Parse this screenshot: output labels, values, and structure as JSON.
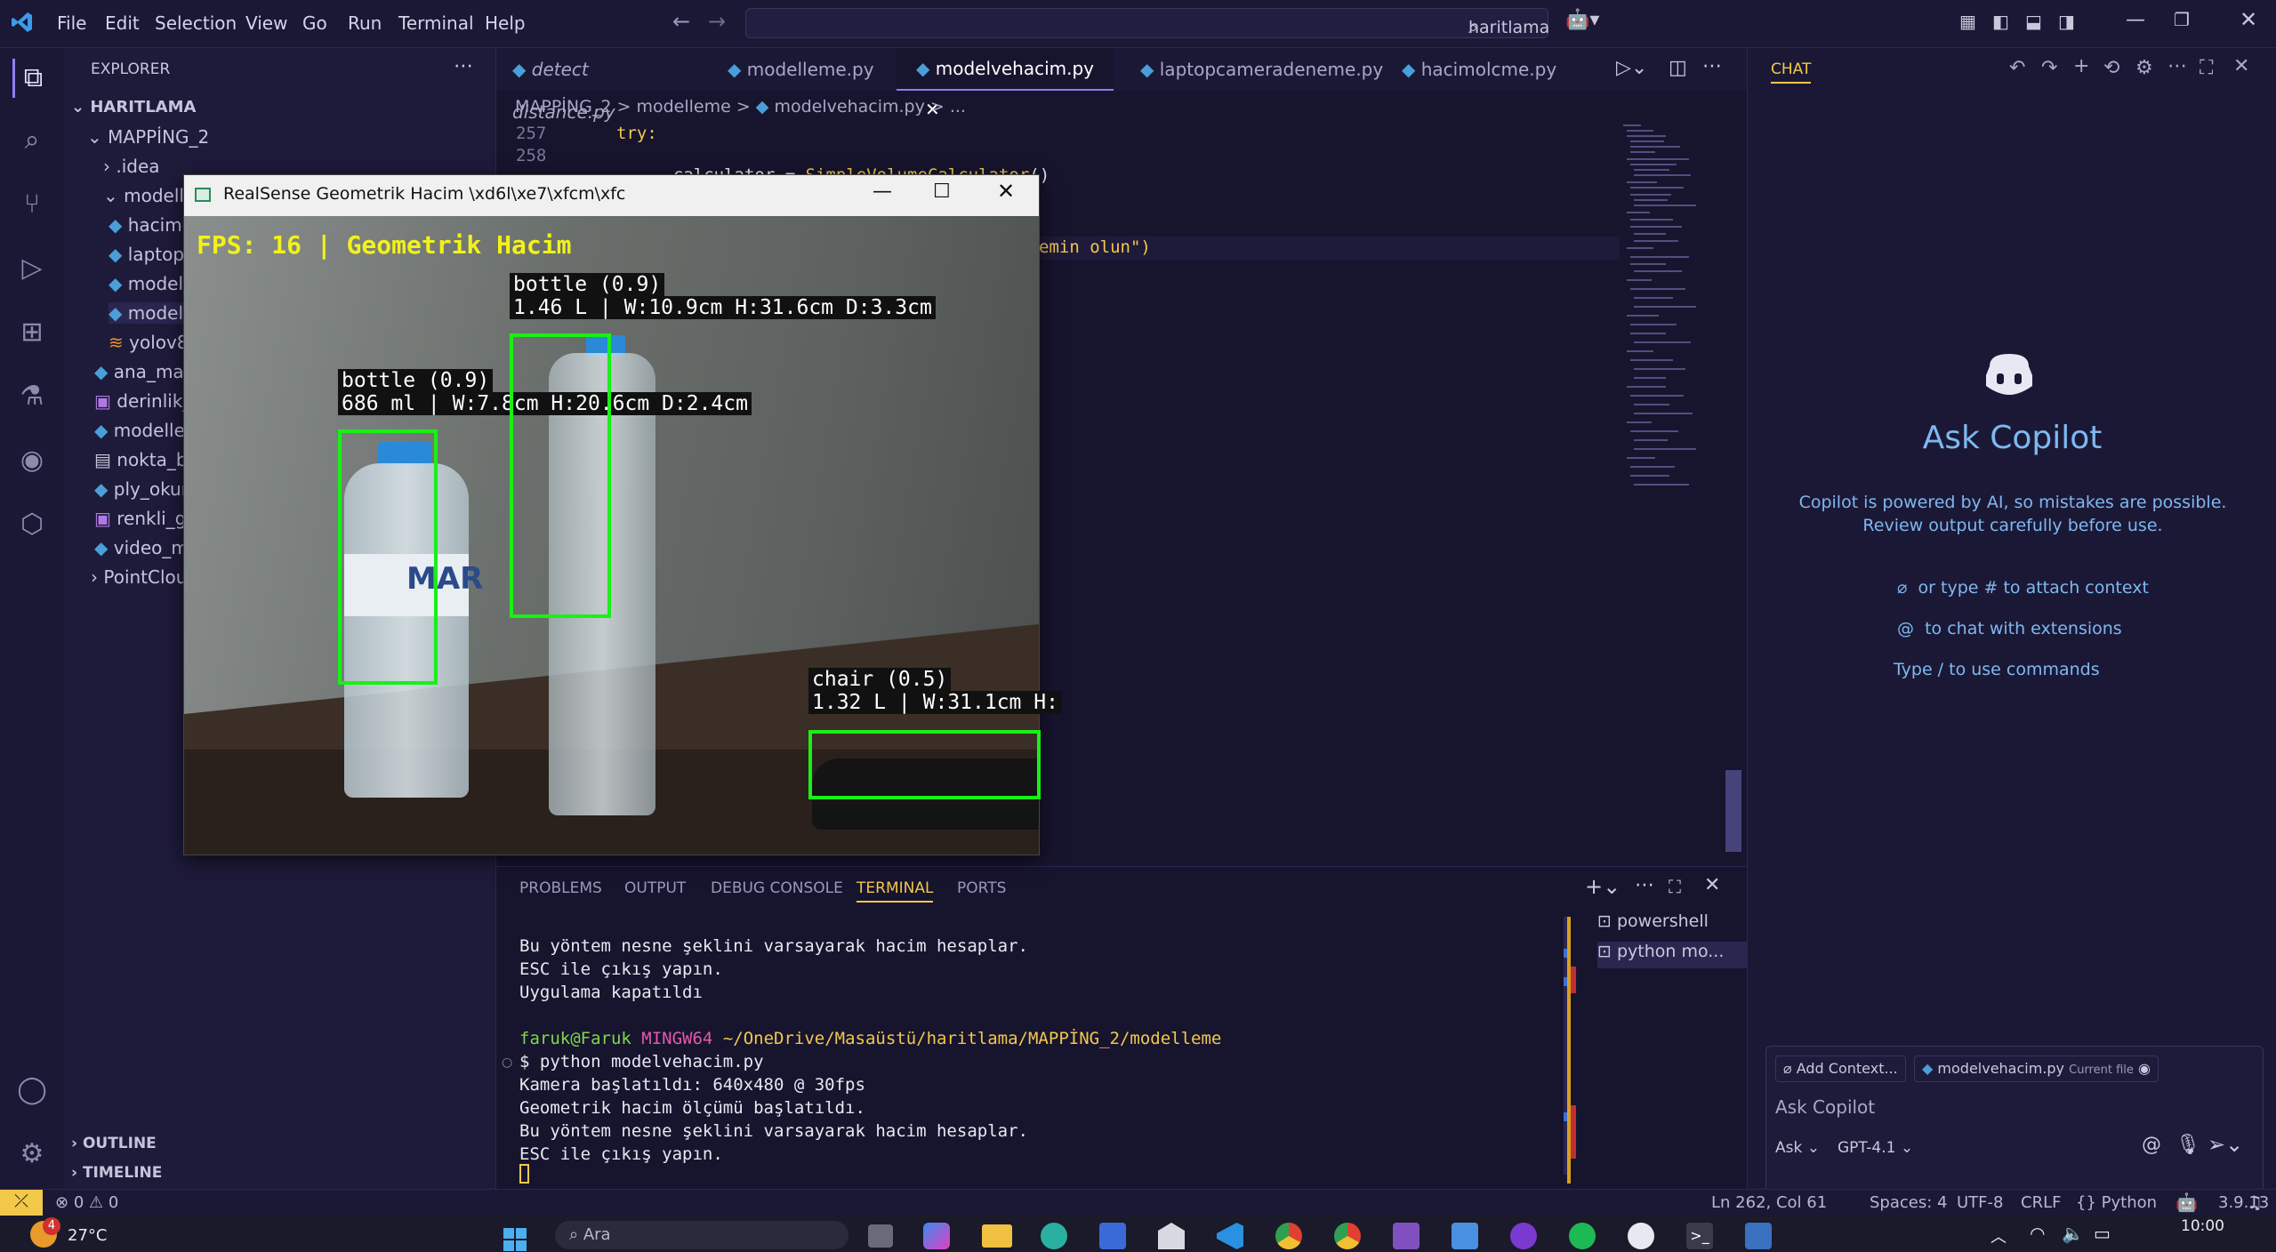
{
  "titlebar": {
    "menu": [
      "File",
      "Edit",
      "Selection",
      "View",
      "Go",
      "Run",
      "Terminal",
      "Help"
    ],
    "search_text": "haritlama"
  },
  "explorer": {
    "header": "EXPLORER",
    "root": "HARITLAMA",
    "folder": "MAPPİNG_2",
    "items": [
      ".idea",
      "modelle",
      "hacimo",
      "laptop",
      "modell",
      "modelv",
      "yolov8",
      "ana_map",
      "derinlik_",
      "modelle",
      "nokta_b",
      "ply_okur",
      "renkli_g",
      "video_m",
      "PointClou"
    ],
    "outline": "OUTLINE",
    "timeline": "TIMELINE"
  },
  "tabs": [
    "detect distance.py",
    "modelleme.py",
    "modelvehacim.py",
    "laptopcameradeneme.py",
    "hacimolcme.py"
  ],
  "breadcrumb": [
    "MAPPİNG_2",
    ">",
    "modelleme",
    ">",
    "modelvehacim.py",
    ">",
    "..."
  ],
  "code": {
    "line_numbers": [
      "257",
      "258"
    ],
    "line257": "try:",
    "line258_var": "calculator",
    "line258_eq": " = ",
    "line258_call": "SimpleVolumeCalculator",
    "line258_paren": "()",
    "fragment": "emin olun\")"
  },
  "camera_window": {
    "title": "RealSense Geometrik Hacim \\xd6l\\xe7\\xfcm\\xfc",
    "fps": "FPS: 16 | Geometrik Hacim",
    "detections": [
      {
        "label1": "bottle (0.9)",
        "label2": "686 ml | W:7.8cm H:20.6cm D:2.4cm"
      },
      {
        "label1": "bottle (0.9)",
        "label2": "1.46 L | W:10.9cm H:31.6cm D:3.3cm"
      },
      {
        "label1": "chair (0.5)",
        "label2": "1.32 L | W:31.1cm H:"
      }
    ],
    "bottle_brand": "MAR"
  },
  "panel": {
    "tabs": [
      "PROBLEMS",
      "OUTPUT",
      "DEBUG CONSOLE",
      "TERMINAL",
      "PORTS"
    ],
    "terminal_lines": [
      "Bu yöntem nesne şeklini varsayarak hacim hesaplar.",
      "ESC ile çıkış yapın.",
      "Uygulama kapatıldı",
      "",
      "",
      "$ python modelvehacim.py",
      "Kamera başlatıldı: 640x480 @ 30fps",
      "Geometrik hacim ölçümü başlatıldı.",
      "Bu yöntem nesne şeklini varsayarak hacim hesaplar.",
      "ESC ile çıkış yapın."
    ],
    "prompt_user": "faruk@Faruk",
    "prompt_host": "MINGW64",
    "prompt_path": "~/OneDrive/Masaüstü/haritlama/MAPPİNG_2/modelleme",
    "shells": [
      "powershell",
      "python mo..."
    ]
  },
  "chat": {
    "header": "CHAT",
    "title": "Ask Copilot",
    "desc": "Copilot is powered by AI, so mistakes are possible. Review output carefully before use.",
    "hint1": "or type # to attach context",
    "hint2": "to chat with extensions",
    "hint3": "Type / to use commands",
    "add_context": "Add Context...",
    "file_chip": "modelvehacim.py",
    "file_chip_sub": "Current file",
    "input_placeholder": "Ask Copilot",
    "mode": "Ask",
    "model": "GPT-4.1"
  },
  "status": {
    "errors": "0",
    "warnings": "0",
    "position": "Ln 262, Col 61",
    "spaces": "Spaces: 4",
    "encoding": "UTF-8",
    "eol": "CRLF",
    "language": "Python",
    "version": "3.9.13"
  },
  "taskbar": {
    "temp": "27°C",
    "badge": "4",
    "search": "Ara",
    "time": "10:00"
  },
  "colors": {
    "accent": "#8f7df7",
    "bbox": "#18f018",
    "fps": "#f2f21a"
  }
}
